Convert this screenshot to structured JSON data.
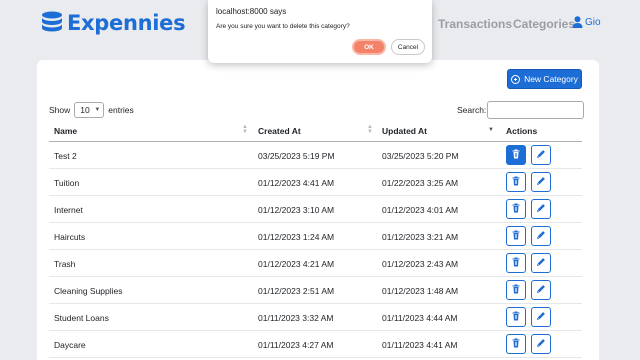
{
  "brand": {
    "name": "Expennies",
    "accent": "#1d6dd6"
  },
  "nav": {
    "links": [
      "Transactions",
      "Categories"
    ],
    "user": "Gio"
  },
  "dialog": {
    "title": "localhost:8000 says",
    "message": "Are you sure you want to delete this category?",
    "ok": "OK",
    "cancel": "Cancel"
  },
  "toolbar": {
    "new_category": "New Category"
  },
  "table_controls": {
    "show_label": "Show",
    "page_size": "10",
    "entries_label": "entries",
    "search_label": "Search:"
  },
  "table": {
    "columns": [
      "Name",
      "Created At",
      "Updated At",
      "Actions"
    ],
    "rows": [
      {
        "name": "Test 2",
        "created": "03/25/2023 5:19 PM",
        "updated": "03/25/2023 5:20 PM"
      },
      {
        "name": "Tuition",
        "created": "01/12/2023 4:41 AM",
        "updated": "01/22/2023 3:25 AM"
      },
      {
        "name": "Internet",
        "created": "01/12/2023 3:10 AM",
        "updated": "01/12/2023 4:01 AM"
      },
      {
        "name": "Haircuts",
        "created": "01/12/2023 1:24 AM",
        "updated": "01/12/2023 3:21 AM"
      },
      {
        "name": "Trash",
        "created": "01/12/2023 4:21 AM",
        "updated": "01/12/2023 2:43 AM"
      },
      {
        "name": "Cleaning Supplies",
        "created": "01/12/2023 2:51 AM",
        "updated": "01/12/2023 1:48 AM"
      },
      {
        "name": "Student Loans",
        "created": "01/11/2023 3:32 AM",
        "updated": "01/11/2023 4:44 AM"
      },
      {
        "name": "Daycare",
        "created": "01/11/2023 4:27 AM",
        "updated": "01/11/2023 4:41 AM"
      }
    ],
    "icons": {
      "delete": "trash-icon",
      "edit": "pencil-icon",
      "sort": "sort-icon"
    }
  }
}
